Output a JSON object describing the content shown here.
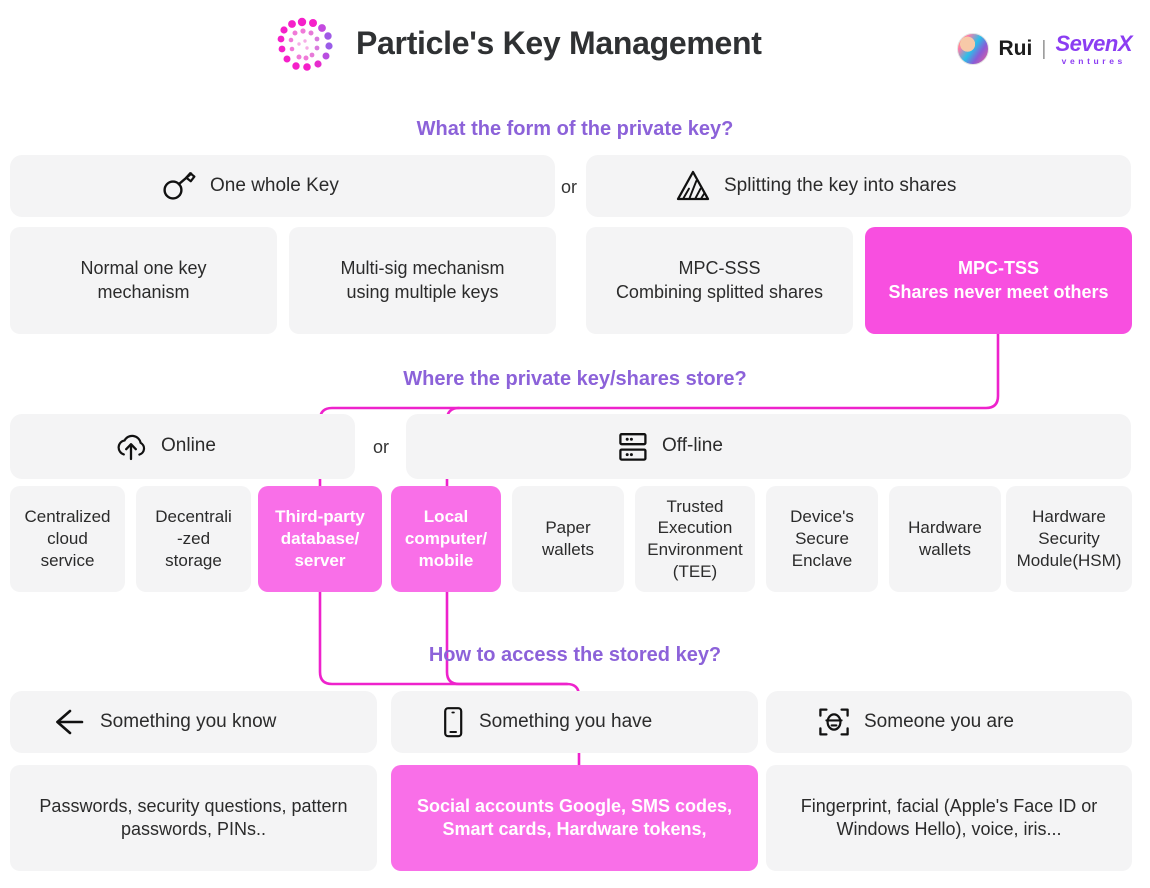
{
  "header": {
    "title": "Particle's Key Management",
    "logo_icon": "particle-spiral-logo",
    "author_name": "Rui",
    "separator": "|",
    "brand_main": "SevenX",
    "brand_sub": "ventures"
  },
  "accent_colors": {
    "question_purple": "#8c62d9",
    "highlight_pink": "#f84fe0",
    "highlight_pink_light": "#f96fe8",
    "card_grey": "#f4f4f5",
    "connector_pink": "#ee22cc"
  },
  "sections": [
    {
      "question": "What the form of the private key?",
      "or_label": "or",
      "options": [
        {
          "icon": "key-icon",
          "label": "One whole Key"
        },
        {
          "icon": "split-shares-icon",
          "label": "Splitting the key into shares"
        }
      ],
      "cards": [
        {
          "lines": [
            "Normal one key",
            "mechanism"
          ],
          "highlight": false
        },
        {
          "lines": [
            "Multi-sig mechanism",
            "using multiple keys"
          ],
          "highlight": false
        },
        {
          "lines": [
            "MPC-SSS",
            "Combining splitted shares"
          ],
          "highlight": false
        },
        {
          "lines": [
            "MPC-TSS",
            "Shares never meet others"
          ],
          "highlight": true
        }
      ]
    },
    {
      "question": "Where the private key/shares store?",
      "or_label": "or",
      "options": [
        {
          "icon": "cloud-upload-icon",
          "label": "Online"
        },
        {
          "icon": "server-rack-icon",
          "label": "Off-line"
        }
      ],
      "cards": [
        {
          "lines": [
            "Centralized",
            "cloud",
            "service"
          ],
          "highlight": false
        },
        {
          "lines": [
            "Decentrali",
            "-zed",
            "storage"
          ],
          "highlight": false
        },
        {
          "lines": [
            "Third-party",
            "database/",
            "server"
          ],
          "highlight": true
        },
        {
          "lines": [
            "Local",
            "computer/",
            "mobile"
          ],
          "highlight": true
        },
        {
          "lines": [
            "Paper",
            "wallets"
          ],
          "highlight": false
        },
        {
          "lines": [
            "Trusted",
            "Execution",
            "Environment",
            "(TEE)"
          ],
          "highlight": false
        },
        {
          "lines": [
            "Device's",
            "Secure",
            "Enclave"
          ],
          "highlight": false
        },
        {
          "lines": [
            "Hardware",
            "wallets"
          ],
          "highlight": false
        },
        {
          "lines": [
            "Hardware",
            "Security",
            "Module(HSM)"
          ],
          "highlight": false
        }
      ]
    },
    {
      "question": "How to access the stored key?",
      "options": [
        {
          "icon": "arrow-left-knowledge-icon",
          "label": "Something you know"
        },
        {
          "icon": "mobile-device-icon",
          "label": "Something you have"
        },
        {
          "icon": "face-scan-icon",
          "label": "Someone you are"
        }
      ],
      "cards": [
        {
          "lines": [
            "Passwords, security questions, pattern",
            "passwords, PINs.."
          ],
          "highlight": false
        },
        {
          "lines": [
            "Social accounts Google, SMS codes,",
            "Smart cards, Hardware tokens,"
          ],
          "highlight": true
        },
        {
          "lines": [
            "Fingerprint, facial (Apple's Face ID or",
            "Windows Hello), voice, iris..."
          ],
          "highlight": false
        }
      ]
    }
  ]
}
